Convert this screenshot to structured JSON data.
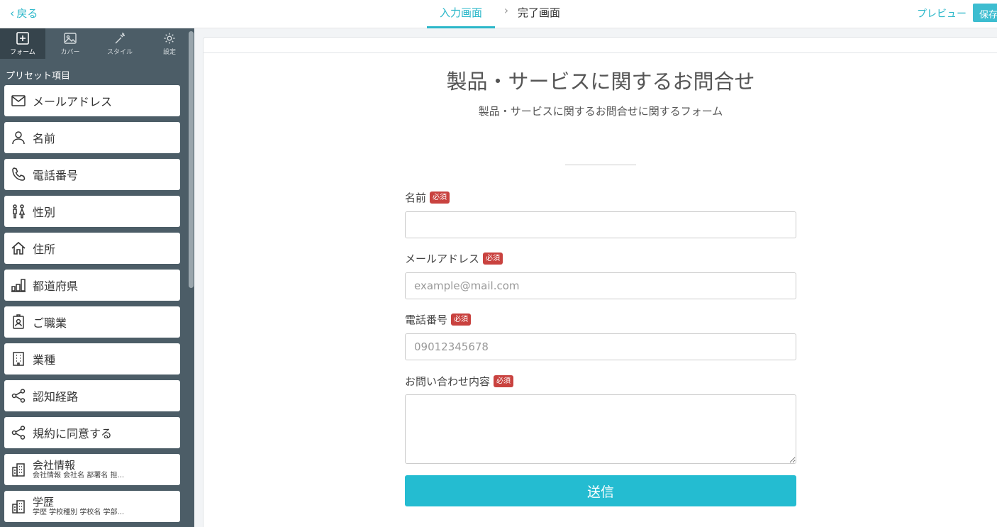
{
  "header": {
    "back_label": "戻る",
    "steps": [
      {
        "label": "入力画面"
      },
      {
        "label": "完了画面"
      }
    ],
    "preview_label": "プレビュー",
    "save_label": "保存"
  },
  "sidebar": {
    "tabs": [
      {
        "label": "フォーム",
        "icon": "plus-square-icon"
      },
      {
        "label": "カバー",
        "icon": "image-icon"
      },
      {
        "label": "スタイル",
        "icon": "wand-icon"
      },
      {
        "label": "設定",
        "icon": "gear-icon"
      }
    ],
    "section_title": "プリセット項目",
    "items": [
      {
        "label": "メールアドレス",
        "icon": "mail-icon"
      },
      {
        "label": "名前",
        "icon": "person-icon"
      },
      {
        "label": "電話番号",
        "icon": "phone-icon"
      },
      {
        "label": "性別",
        "icon": "gender-icon"
      },
      {
        "label": "住所",
        "icon": "home-icon"
      },
      {
        "label": "都道府県",
        "icon": "city-icon"
      },
      {
        "label": "ご職業",
        "icon": "badge-icon"
      },
      {
        "label": "業種",
        "icon": "building-icon"
      },
      {
        "label": "認知経路",
        "icon": "share-icon"
      },
      {
        "label": "規約に同意する",
        "icon": "share-icon"
      },
      {
        "label": "会社情報",
        "sub": "会社情報 会社名 部署名 担...",
        "icon": "office-icon"
      },
      {
        "label": "学歴",
        "sub": "学歴 学校種別 学校名 学部...",
        "icon": "office-icon"
      }
    ]
  },
  "form": {
    "title": "製品・サービスに関するお問合せ",
    "description": "製品・サービスに関するお問合せに関するフォーム",
    "required_badge": "必須",
    "fields": [
      {
        "label": "名前",
        "value": "",
        "placeholder": ""
      },
      {
        "label": "メールアドレス",
        "value": "",
        "placeholder": "example@mail.com"
      },
      {
        "label": "電話番号",
        "value": "",
        "placeholder": "09012345678"
      },
      {
        "label": "お問い合わせ内容",
        "value": "",
        "placeholder": ""
      }
    ],
    "submit_label": "送信"
  },
  "colors": {
    "accent": "#2bb7c9",
    "sidebar_bg": "#4c5d67",
    "required": "#c9423f",
    "submit": "#24bcd1"
  }
}
